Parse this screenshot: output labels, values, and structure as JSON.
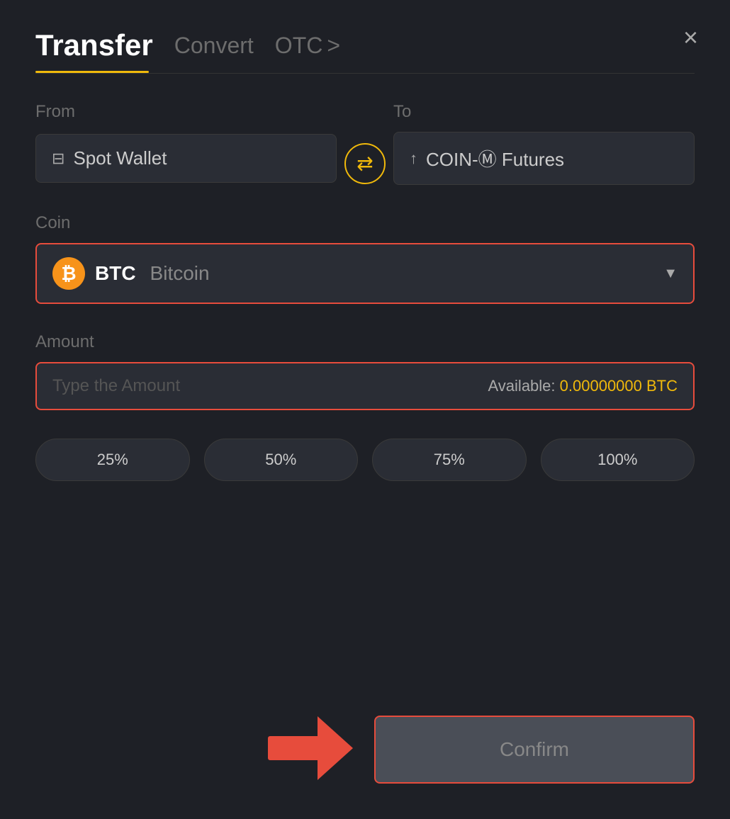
{
  "header": {
    "title": "Transfer",
    "tab_convert": "Convert",
    "tab_otc": "OTC",
    "tab_otc_chevron": ">",
    "close_label": "×"
  },
  "from": {
    "label": "From",
    "wallet_label": "Spot Wallet",
    "wallet_icon": "💳"
  },
  "to": {
    "label": "To",
    "wallet_label": "COIN-Ⓜ Futures",
    "wallet_icon": "↑"
  },
  "swap": {
    "icon": "⇄"
  },
  "coin": {
    "label": "Coin",
    "symbol": "BTC",
    "name": "Bitcoin",
    "btc_letter": "₿"
  },
  "amount": {
    "label": "Amount",
    "placeholder": "Type the Amount",
    "available_label": "Available:",
    "available_value": "0.00000000 BTC"
  },
  "percentages": [
    {
      "label": "25%",
      "value": 25
    },
    {
      "label": "50%",
      "value": 50
    },
    {
      "label": "75%",
      "value": 75
    },
    {
      "label": "100%",
      "value": 100
    }
  ],
  "confirm": {
    "label": "Confirm"
  },
  "colors": {
    "accent": "#f0b90b",
    "danger": "#e74c3c",
    "bg": "#1e2026",
    "card": "#2a2d35"
  }
}
